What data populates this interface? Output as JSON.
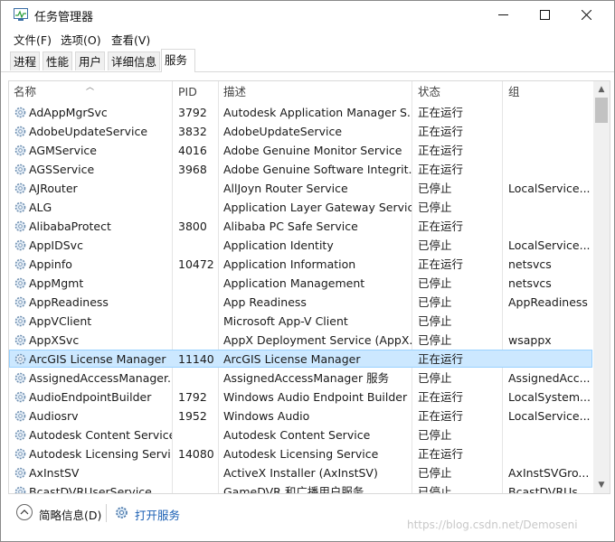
{
  "window": {
    "title": "任务管理器",
    "icon": "task-manager-icon",
    "controls": [
      "minimize-icon",
      "maximize-icon",
      "close-icon"
    ]
  },
  "menu": [
    {
      "label": "文件(F)"
    },
    {
      "label": "选项(O)"
    },
    {
      "label": "查看(V)"
    }
  ],
  "tabs": [
    {
      "label": "进程",
      "active": false
    },
    {
      "label": "性能",
      "active": false
    },
    {
      "label": "用户",
      "active": false
    },
    {
      "label": "详细信息",
      "active": false
    },
    {
      "label": "服务",
      "active": true
    }
  ],
  "columns": {
    "name": "名称",
    "pid": "PID",
    "desc": "描述",
    "status": "状态",
    "group": "组"
  },
  "rows": [
    {
      "name": "AdAppMgrSvc",
      "pid": "3792",
      "desc": "Autodesk Application Manager S...",
      "status": "正在运行",
      "group": ""
    },
    {
      "name": "AdobeUpdateService",
      "pid": "3832",
      "desc": "AdobeUpdateService",
      "status": "正在运行",
      "group": ""
    },
    {
      "name": "AGMService",
      "pid": "4016",
      "desc": "Adobe Genuine Monitor Service",
      "status": "正在运行",
      "group": ""
    },
    {
      "name": "AGSService",
      "pid": "3968",
      "desc": "Adobe Genuine Software Integrit...",
      "status": "正在运行",
      "group": ""
    },
    {
      "name": "AJRouter",
      "pid": "",
      "desc": "AllJoyn Router Service",
      "status": "已停止",
      "group": "LocalService..."
    },
    {
      "name": "ALG",
      "pid": "",
      "desc": "Application Layer Gateway Service",
      "status": "已停止",
      "group": ""
    },
    {
      "name": "AlibabaProtect",
      "pid": "3800",
      "desc": "Alibaba PC Safe Service",
      "status": "正在运行",
      "group": ""
    },
    {
      "name": "AppIDSvc",
      "pid": "",
      "desc": "Application Identity",
      "status": "已停止",
      "group": "LocalService..."
    },
    {
      "name": "Appinfo",
      "pid": "10472",
      "desc": "Application Information",
      "status": "正在运行",
      "group": "netsvcs"
    },
    {
      "name": "AppMgmt",
      "pid": "",
      "desc": "Application Management",
      "status": "已停止",
      "group": "netsvcs"
    },
    {
      "name": "AppReadiness",
      "pid": "",
      "desc": "App Readiness",
      "status": "已停止",
      "group": "AppReadiness"
    },
    {
      "name": "AppVClient",
      "pid": "",
      "desc": "Microsoft App-V Client",
      "status": "已停止",
      "group": ""
    },
    {
      "name": "AppXSvc",
      "pid": "",
      "desc": "AppX Deployment Service (AppX...",
      "status": "已停止",
      "group": "wsappx"
    },
    {
      "name": "ArcGIS License Manager",
      "pid": "11140",
      "desc": "ArcGIS License Manager",
      "status": "正在运行",
      "group": "",
      "selected": true
    },
    {
      "name": "AssignedAccessManager...",
      "pid": "",
      "desc": "AssignedAccessManager 服务",
      "status": "已停止",
      "group": "AssignedAcc..."
    },
    {
      "name": "AudioEndpointBuilder",
      "pid": "1792",
      "desc": "Windows Audio Endpoint Builder",
      "status": "正在运行",
      "group": "LocalSystem..."
    },
    {
      "name": "Audiosrv",
      "pid": "1952",
      "desc": "Windows Audio",
      "status": "正在运行",
      "group": "LocalService..."
    },
    {
      "name": "Autodesk Content Service",
      "pid": "",
      "desc": "Autodesk Content Service",
      "status": "已停止",
      "group": ""
    },
    {
      "name": "Autodesk Licensing Servi...",
      "pid": "14080",
      "desc": "Autodesk Licensing Service",
      "status": "正在运行",
      "group": ""
    },
    {
      "name": "AxInstSV",
      "pid": "",
      "desc": "ActiveX Installer (AxInstSV)",
      "status": "已停止",
      "group": "AxInstSVGro..."
    },
    {
      "name": "BcastDVRUserService...",
      "pid": "",
      "desc": "GameDVR 和广播用户服务",
      "status": "已停止",
      "group": "BcastDVRUs..."
    }
  ],
  "footer": {
    "collapse_label": "简略信息(D)",
    "open_services_label": "打开服务"
  },
  "watermark": "https://blog.csdn.net/Demoseni",
  "colors": {
    "selection_bg": "#cce8ff",
    "selection_border": "#99d1ff",
    "link": "#1a5fb4"
  }
}
